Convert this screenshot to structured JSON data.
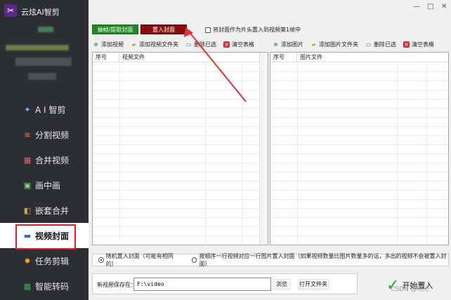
{
  "app": {
    "title": "云炫AI智剪"
  },
  "window_controls": [
    "—",
    "□",
    "✕"
  ],
  "sidebar": {
    "items": [
      {
        "label": "A I 智剪",
        "icon": "ai-edit-icon",
        "active": false
      },
      {
        "label": "分割视频",
        "icon": "split-video-icon",
        "active": false
      },
      {
        "label": "合并视频",
        "icon": "merge-video-icon",
        "active": false
      },
      {
        "label": "画中画",
        "icon": "picture-in-picture-icon",
        "active": false
      },
      {
        "label": "嵌套合并",
        "icon": "nest-merge-icon",
        "active": false
      },
      {
        "label": "视频封面",
        "icon": "video-cover-icon",
        "active": true
      },
      {
        "label": "任务剪辑",
        "icon": "task-edit-icon",
        "active": false
      },
      {
        "label": "智能转码",
        "icon": "transcode-icon",
        "active": false
      }
    ]
  },
  "top": {
    "extract_tab": "抽帧/提取封面",
    "place_tab": "置入封面",
    "first_frame_checkbox": "将封面作为片头置入到视频第1帧中"
  },
  "video_toolbar": {
    "add_video": "添加视频",
    "add_video_folder": "添加视频文件夹",
    "delete_selected": "删除已选",
    "clear_table": "清空表格"
  },
  "image_toolbar": {
    "add_image": "添加图片",
    "add_image_folder": "添加图片文件夹",
    "delete_selected": "删除已选",
    "clear_table": "清空表格"
  },
  "video_table": {
    "columns": [
      "序号",
      "视频文件"
    ]
  },
  "image_table": {
    "columns": [
      "序号",
      "图片文件"
    ]
  },
  "options": {
    "random": "随机置入封面（可能有相同的）",
    "sequential": "按顺序一行视频对应一行图片置入封面（如果视频数量比图片数量多的话，多出的视频不会被置入封面）",
    "selected": "random"
  },
  "save": {
    "label": "新视频保存在：",
    "path": "F:\\video",
    "browse": "浏览",
    "open_folder": "打开文件夹"
  },
  "start": {
    "label": "开始置入"
  },
  "watermark": "CSDN @叫沁",
  "colors": {
    "extract_tab": "#1f8a1f",
    "place_tab": "#8b0e0e",
    "sidebar_bg": "#2b2f33",
    "active_highlight": "#e02020",
    "arrow": "#e53030"
  }
}
